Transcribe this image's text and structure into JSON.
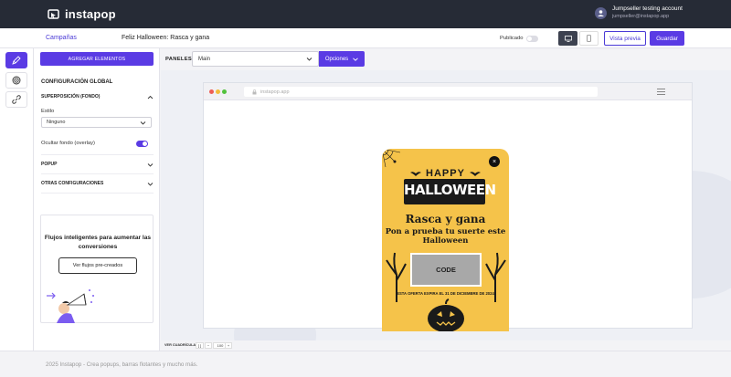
{
  "brand": {
    "name": "instapop"
  },
  "account": {
    "name": "Jumpseller testing account",
    "email": "jumpseller@instapop.app"
  },
  "subbar": {
    "campaigns_link": "Campañas",
    "page_title": "Feliz Halloween: Rasca y gana",
    "published_label": "Publicado",
    "preview_label": "Vista previa",
    "save_label": "Guardar"
  },
  "sidebar": {
    "add_elements_label": "AGREGAR ELEMENTOS",
    "global_config_title": "CONFIGURACIÓN GLOBAL",
    "overlay_section": "SUPERPOSICIÓN (FONDO)",
    "style_label": "Estilo",
    "style_value": "Ninguno",
    "hide_overlay_label": "Ocultar fondo (overlay)",
    "popup_section": "POPUP",
    "other_config_section": "OTRAS CONFIGURACIONES",
    "promo_title": "Flujos inteligentes para aumentar las conversiones",
    "promo_button": "Ver flujos pre-creados"
  },
  "toolbar": {
    "panels_label": "PANELES",
    "panel_value": "Main",
    "options_label": "Opciones"
  },
  "browser": {
    "url": "instapop.app"
  },
  "popup": {
    "happy": "HAPPY",
    "halloween": "HALLOWEEN",
    "headline": "Rasca y gana",
    "subheadline": "Pon a prueba tu suerte este Halloween",
    "code": "CODE",
    "expiry": "ESTA OFERTA EXPIRA EL 31 DE DICIEMBRE DE 2024",
    "close": "×"
  },
  "zoom": {
    "grid_label": "VER CUADRÍCULA",
    "fit_label": "[ ]",
    "minus": "−",
    "value": "100",
    "plus": "+"
  },
  "footer": {
    "text": "2025 Instapop - Crea popups, barras flotantes y mucho más."
  },
  "colors": {
    "accent": "#5a3be4",
    "topbar": "#262b36",
    "popup_bg": "#f5c34a"
  }
}
